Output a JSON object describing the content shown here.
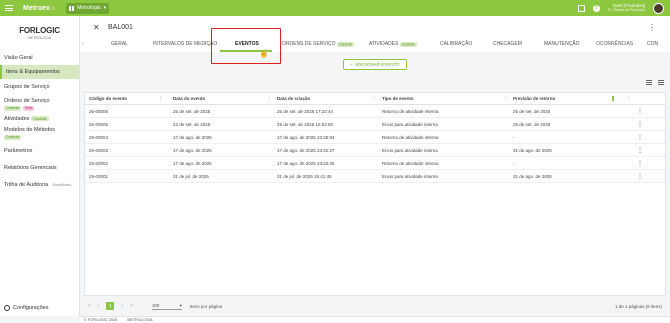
{
  "topbar": {
    "brand": "Metroex",
    "brand_mark": "☼",
    "app": "Metrologia",
    "user_name": "Dani [Produtiva]",
    "user_role": "FL Gestão de Produção"
  },
  "sidebar": {
    "logo_main": "FORLOGIC",
    "logo_sub": "METROLOGIA",
    "items": [
      {
        "label": "Visão Geral"
      },
      {
        "label": "Itens & Equipamentos"
      },
      {
        "label": "Grupos de Serviço"
      },
      {
        "label": "Ordens de Serviço",
        "badges": [
          "Controle",
          "Beta"
        ]
      },
      {
        "label": "Atividades",
        "badges": [
          "Controle"
        ]
      },
      {
        "label": "Modelos de Métodos",
        "badges": [
          "Controle"
        ]
      },
      {
        "label": "Parâmetros"
      },
      {
        "label": "Relatórios Gerenciais"
      },
      {
        "label": "Trilha de Auditoria",
        "badges": [
          "Simplificado"
        ]
      }
    ],
    "config_label": "Configurações"
  },
  "header": {
    "title": "BAL001",
    "tabs": [
      {
        "label": "GERAL"
      },
      {
        "label": "INTERVALOS DE MEDIÇÃO"
      },
      {
        "label": "EVENTOS"
      },
      {
        "label": "ORDENS DE SERVIÇO",
        "badge": "Controle"
      },
      {
        "label": "ATIVIDADES",
        "badge": "Controle"
      },
      {
        "label": "CALIBRAÇÃO"
      },
      {
        "label": "CHECAGEM"
      },
      {
        "label": "MANUTENÇÃO"
      },
      {
        "label": "OCORRÊNCIAS"
      },
      {
        "label": "CON"
      }
    ]
  },
  "content": {
    "add_button": "ADICIONAR EVENTO",
    "columns": [
      "Código do evento",
      "Data do evento",
      "Data de criação",
      "Tipo de evento",
      "Previsão de retorno"
    ],
    "rows": [
      [
        "25-00006",
        "25 de set. de 2025",
        "25 de set. de 2025 17:22:44",
        "Retorno de atividade interna",
        "25 de set. de 2025"
      ],
      [
        "25-00005",
        "22 de set. de 2025",
        "25 de set. de 2025 15:52:50",
        "Envio para atividade interna",
        "25 de set. de 2025"
      ],
      [
        "25-00004",
        "17 de ago. de 2025",
        "17 de ago. de 2025 23:25:04",
        "Retorno de atividade interna",
        "-"
      ],
      [
        "25-00003",
        "17 de ago. de 2025",
        "17 de ago. de 2025 23:22:27",
        "Envio para atividade interna",
        "31 de ago. de 2025"
      ],
      [
        "25-00002",
        "17 de ago. de 2025",
        "17 de ago. de 2025 23:22:25",
        "Retorno de atividade interna",
        "-"
      ],
      [
        "25-00001",
        "31 de jul. de 2025",
        "31 de jul. de 2025 15:41:45",
        "Envio para atividade interna",
        "31 de ago. de 2025"
      ]
    ],
    "page": "1",
    "page_size": "100",
    "page_size_label": "Itens por página",
    "page_info": "1 de 1 páginas (6 itens)"
  },
  "footer": {
    "copyright": "© FORLOGIC 2025",
    "module": "METROLOGIA"
  },
  "colors": {
    "accent": "#8dc63f",
    "highlight": "#e02020"
  }
}
